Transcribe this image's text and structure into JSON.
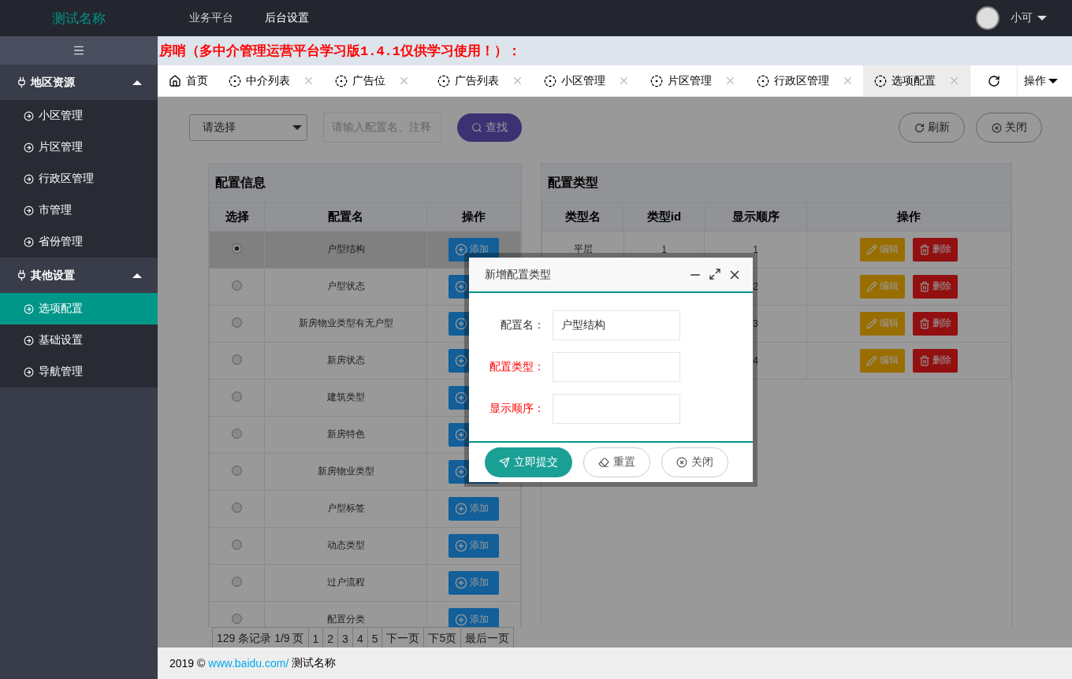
{
  "header": {
    "logo": "测试名称",
    "nav": [
      {
        "label": "业务平台",
        "selected": false
      },
      {
        "label": "后台设置",
        "selected": true
      }
    ],
    "user": "小可"
  },
  "sidebar": {
    "groups": [
      {
        "label": "地区资源",
        "expanded": true,
        "items": [
          {
            "label": "小区管理",
            "selected": false
          },
          {
            "label": "片区管理",
            "selected": false
          },
          {
            "label": "行政区管理",
            "selected": false
          },
          {
            "label": "市管理",
            "selected": false
          },
          {
            "label": "省份管理",
            "selected": false
          }
        ]
      },
      {
        "label": "其他设置",
        "expanded": true,
        "items": [
          {
            "label": "选项配置",
            "selected": true
          },
          {
            "label": "基础设置",
            "selected": false
          },
          {
            "label": "导航管理",
            "selected": false
          }
        ]
      }
    ]
  },
  "notice": "房哨（多中介管理运营平台学习版1.4.1仅供学习使用！）：",
  "tabs": [
    {
      "label": "首页",
      "kind": "home",
      "selected": false
    },
    {
      "label": "中介列表",
      "kind": "page",
      "selected": false
    },
    {
      "label": "广告位",
      "kind": "page",
      "selected": false
    },
    {
      "label": "广告列表",
      "kind": "page",
      "selected": false
    },
    {
      "label": "小区管理",
      "kind": "page",
      "selected": false
    },
    {
      "label": "片区管理",
      "kind": "page",
      "selected": false
    },
    {
      "label": "行政区管理",
      "kind": "page",
      "selected": false
    },
    {
      "label": "选项配置",
      "kind": "page",
      "selected": true
    }
  ],
  "tab_menu": "操作",
  "toolbar": {
    "select": "请选择",
    "search_placeholder": "请输入配置名、注释",
    "search_button": "查找",
    "refresh": "刷新",
    "close": "关闭"
  },
  "config_info": {
    "title": "配置信息",
    "columns": [
      "选择",
      "配置名",
      "操作"
    ],
    "rows": [
      {
        "name": "户型结构",
        "selected": true,
        "action": "添加"
      },
      {
        "name": "户型状态",
        "selected": false
      },
      {
        "name": "新房物业类型有无户型",
        "selected": false
      },
      {
        "name": "新房状态",
        "selected": false
      },
      {
        "name": "建筑类型",
        "selected": false
      },
      {
        "name": "新房特色",
        "selected": false
      },
      {
        "name": "新房物业类型",
        "selected": false
      },
      {
        "name": "户型标签",
        "selected": false,
        "action": "添加"
      },
      {
        "name": "动态类型",
        "selected": false,
        "action": "添加"
      },
      {
        "name": "过户流程",
        "selected": false,
        "action": "添加"
      },
      {
        "name": "配置分类",
        "selected": false,
        "action": "添加"
      }
    ]
  },
  "config_type": {
    "title": "配置类型",
    "columns": [
      "类型名",
      "类型id",
      "显示顺序",
      "操作"
    ],
    "rows": [
      {
        "type_name": "平层",
        "type_id": "1",
        "order": "1",
        "edit": "编辑",
        "delete": "删除"
      },
      {
        "order": "2",
        "edit": "编辑",
        "delete": "删除"
      },
      {
        "order": "3",
        "edit": "编辑",
        "delete": "删除"
      },
      {
        "order": "4",
        "edit": "编辑",
        "delete": "删除"
      }
    ]
  },
  "pagination": {
    "summary": "129 条记录 1/9 页",
    "links": [
      "1",
      "2",
      "3",
      "4",
      "5",
      "下一页",
      "下5页",
      "最后一页"
    ]
  },
  "footer": {
    "year": "2019 ©",
    "link": "www.baidu.com/",
    "name": "测试名称"
  },
  "dialog": {
    "title": "新增配置类型",
    "fields": [
      {
        "label": "配置名：",
        "value": "户型结构",
        "required": false
      },
      {
        "label": "配置类型：",
        "required": true
      },
      {
        "label": "显示顺序：",
        "required": true
      }
    ],
    "buttons": [
      {
        "label": "立即提交",
        "kind": "primary"
      },
      {
        "label": "重置",
        "kind": "reset"
      },
      {
        "label": "关闭",
        "kind": "close"
      }
    ]
  }
}
